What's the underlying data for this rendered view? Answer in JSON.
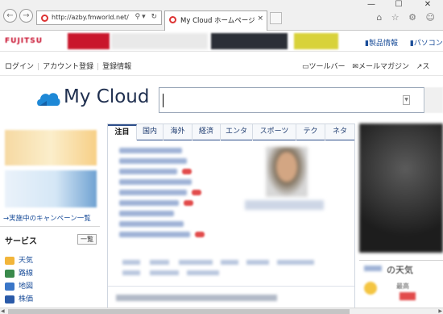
{
  "browser": {
    "url": "http://azby.fmworld.net/",
    "tab_title": "My Cloud ホームページ",
    "tab_close": "×",
    "address_icons": "⚲▾ ↻",
    "back_icon": "←",
    "forward_icon": "→",
    "window_controls": [
      "—",
      "☐",
      "✕"
    ],
    "tools_icons": "⌂ ☆ ⚙ ☺"
  },
  "ad_bar": {
    "brand": "FUJITSU",
    "links": [
      "製品情報",
      "パソコン"
    ]
  },
  "top_links": {
    "left": [
      "ログイン",
      "アカウント登録",
      "登録情報"
    ],
    "right": [
      {
        "icon": "toolbar-icon",
        "label": "ツールバー"
      },
      {
        "icon": "mail-icon",
        "label": "メールマガジン"
      },
      {
        "icon": "more-icon",
        "label": "ス"
      }
    ]
  },
  "logo": {
    "text": "My Cloud"
  },
  "search": {
    "value": ""
  },
  "left": {
    "campaign_link": "→実施中のキャンペーン一覧",
    "services_title": "サービス",
    "services_more": "一覧",
    "services": [
      {
        "label": "天気",
        "icon": "weather-icon",
        "color": "#f2b53a"
      },
      {
        "label": "路線",
        "icon": "train-icon",
        "color": "#3a8a4b"
      },
      {
        "label": "地図",
        "icon": "map-icon",
        "color": "#3a76c8"
      },
      {
        "label": "株価",
        "icon": "stock-icon",
        "color": "#2a5aa8"
      }
    ]
  },
  "news": {
    "tabs": [
      "注目",
      "国内",
      "海外",
      "経済",
      "エンタ",
      "スポーツ",
      "テク",
      "ネタ"
    ],
    "active_tab": "注目"
  },
  "right": {
    "weather_title": "の天気",
    "weather_label": "最高"
  },
  "colors": {
    "accent": "#2e4f8a",
    "link": "#1a4d99",
    "fujitsu_red": "#c8102e"
  }
}
